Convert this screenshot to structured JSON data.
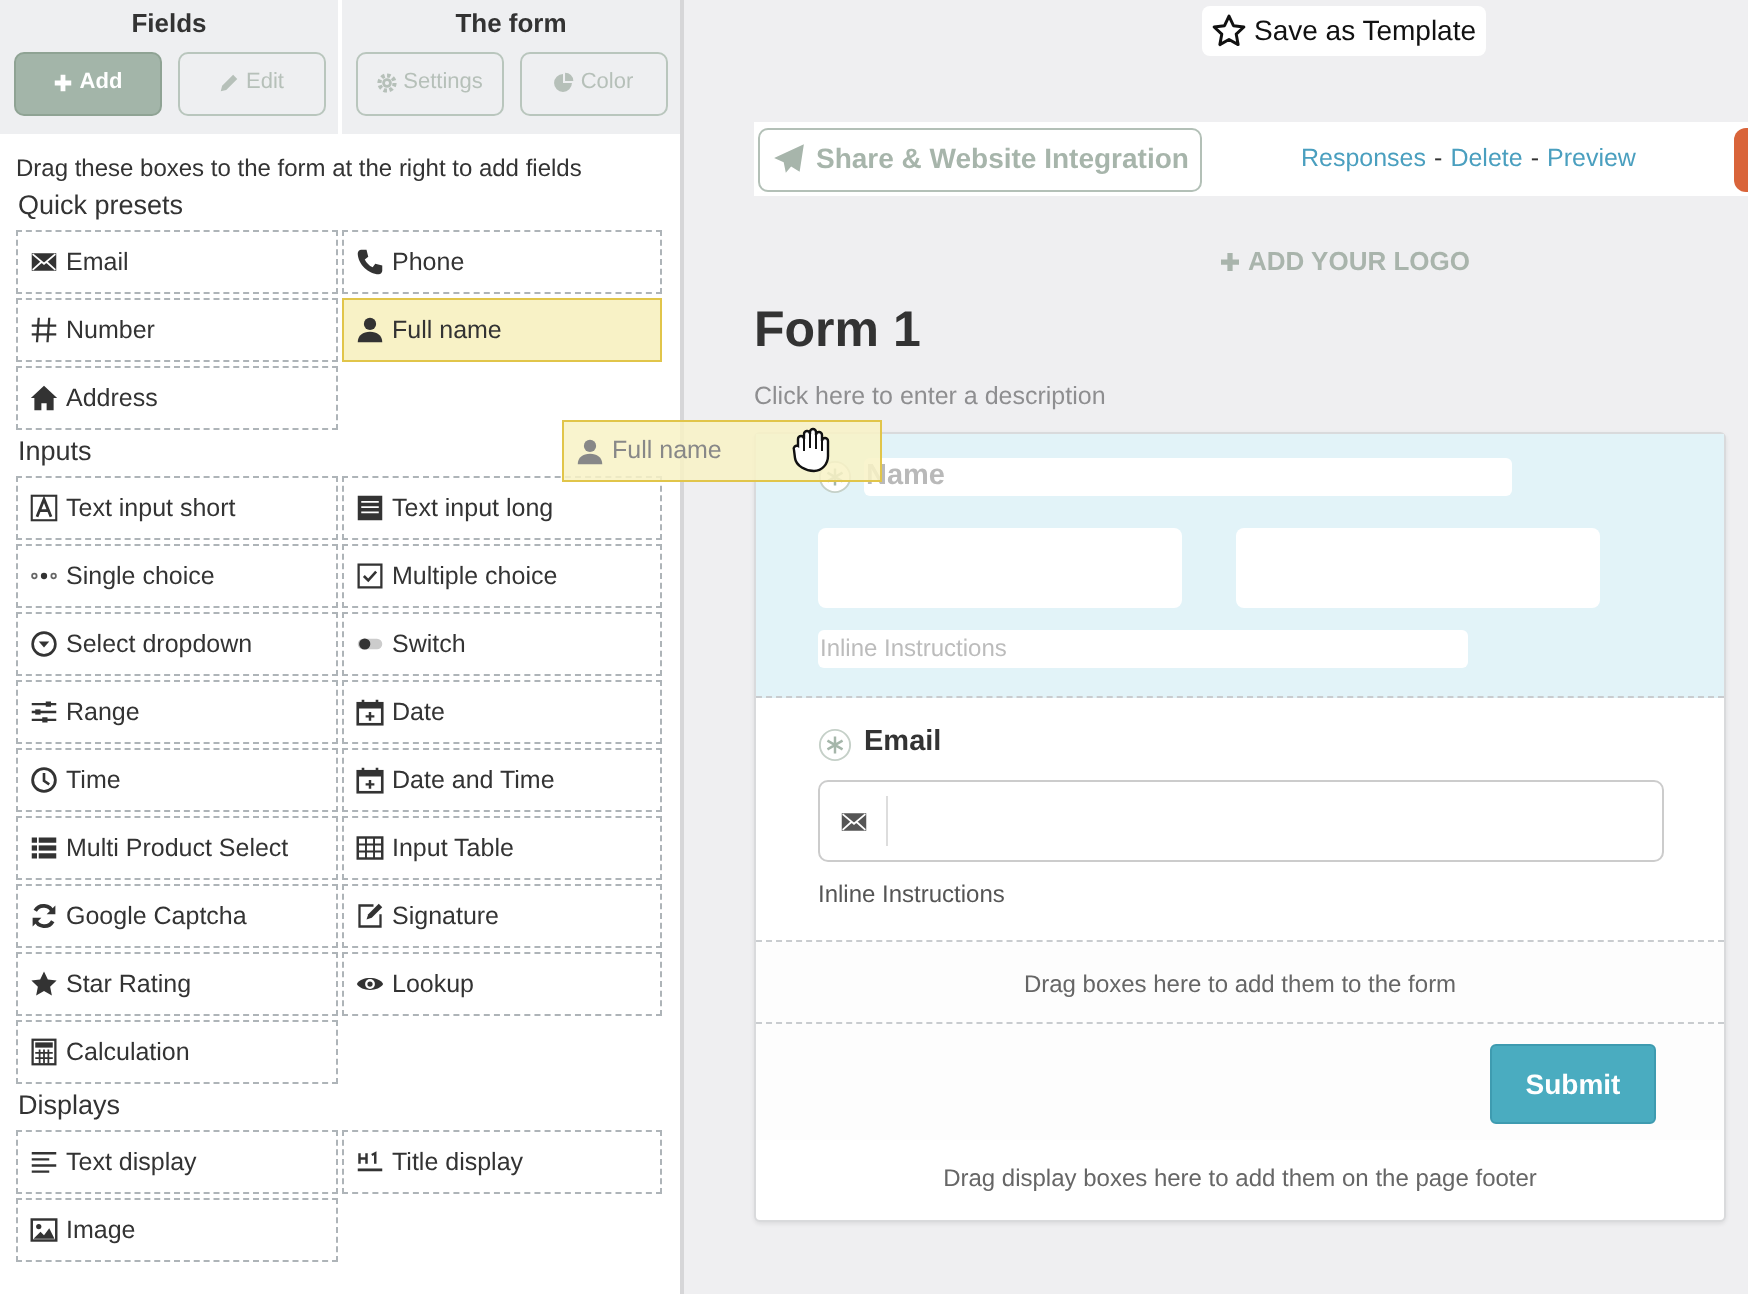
{
  "left_panel": {
    "groups": [
      {
        "title": "Fields",
        "buttons": [
          {
            "label": "Add",
            "kind": "add",
            "selected": true
          },
          {
            "label": "Edit",
            "kind": "edit",
            "selected": false
          }
        ]
      },
      {
        "title": "The form",
        "buttons": [
          {
            "label": "Settings",
            "kind": "settings",
            "selected": false
          },
          {
            "label": "Color",
            "kind": "color",
            "selected": false
          }
        ]
      }
    ],
    "hint": "Drag these boxes to the form at the right to add fields",
    "sections": [
      {
        "title": "Quick presets",
        "items": [
          {
            "label": "Email",
            "kind": "email",
            "selected": false
          },
          {
            "label": "Phone",
            "kind": "phone",
            "selected": false
          },
          {
            "label": "Number",
            "kind": "number",
            "selected": false
          },
          {
            "label": "Full name",
            "kind": "person",
            "selected": true
          },
          {
            "label": "Address",
            "kind": "address",
            "selected": false
          }
        ]
      },
      {
        "title": "Inputs",
        "items": [
          {
            "label": "Text input short",
            "kind": "textshort",
            "selected": false
          },
          {
            "label": "Text input long",
            "kind": "textlong",
            "selected": false
          },
          {
            "label": "Single choice",
            "kind": "single",
            "selected": false
          },
          {
            "label": "Multiple choice",
            "kind": "multiple",
            "selected": false
          },
          {
            "label": "Select dropdown",
            "kind": "dropdown",
            "selected": false
          },
          {
            "label": "Switch",
            "kind": "switch",
            "selected": false
          },
          {
            "label": "Range",
            "kind": "range",
            "selected": false
          },
          {
            "label": "Date",
            "kind": "date",
            "selected": false
          },
          {
            "label": "Time",
            "kind": "time",
            "selected": false
          },
          {
            "label": "Date and Time",
            "kind": "date",
            "selected": false
          },
          {
            "label": "Multi Product Select",
            "kind": "list",
            "selected": false
          },
          {
            "label": "Input Table",
            "kind": "table",
            "selected": false
          },
          {
            "label": "Google Captcha",
            "kind": "refresh",
            "selected": false
          },
          {
            "label": "Signature",
            "kind": "signature",
            "selected": false
          },
          {
            "label": "Star Rating",
            "kind": "star",
            "selected": false
          },
          {
            "label": "Lookup",
            "kind": "eye",
            "selected": false
          },
          {
            "label": "Calculation",
            "kind": "calculator",
            "selected": false
          }
        ]
      },
      {
        "title": "Displays",
        "items": [
          {
            "label": "Text display",
            "kind": "lines",
            "selected": false
          },
          {
            "label": "Title display",
            "kind": "heading",
            "selected": false
          },
          {
            "label": "Image",
            "kind": "image",
            "selected": false
          }
        ]
      }
    ]
  },
  "drag_ghost": {
    "label": "Full name",
    "kind": "person"
  },
  "save_template": {
    "label": "Save as Template"
  },
  "toolbar": {
    "share": "Share & Website Integration",
    "links": [
      "Responses",
      "Delete",
      "Preview"
    ],
    "separators": [
      "-",
      "-"
    ]
  },
  "add_logo": "ADD YOUR LOGO",
  "form": {
    "title": "Form 1",
    "description_placeholder": "Click here to enter a description",
    "fields": [
      {
        "kind": "name",
        "label": "Name",
        "required": true,
        "selected": true,
        "instructions": "Inline Instructions"
      },
      {
        "kind": "email",
        "label": "Email",
        "required": true,
        "selected": false,
        "instructions": "Inline Instructions"
      }
    ],
    "drop_hint": "Drag boxes here to add them to the form",
    "submit": "Submit",
    "footer_hint": "Drag display boxes here to add them on the page footer"
  }
}
